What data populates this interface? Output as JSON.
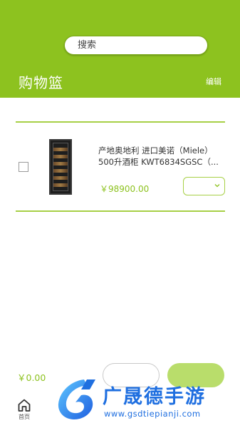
{
  "header": {
    "search_placeholder": "搜索",
    "title": "购物篮",
    "edit_label": "编辑"
  },
  "cart": {
    "items": [
      {
        "checked": false,
        "name_line1": "产地奥地利 进口美诺（Miele）",
        "name_line2": "500升酒柜 KWT6834SGSC（...",
        "price": "￥98900.00",
        "quantity": ""
      }
    ]
  },
  "summary": {
    "total": "￥0.00",
    "secondary_button_label": "",
    "primary_button_label": ""
  },
  "nav": {
    "home_label": "首页"
  },
  "watermark": {
    "brand": "广晟德手游",
    "url": "www.gsdtiepianji.com"
  },
  "colors": {
    "accent": "#8dc21f",
    "accent_light": "#b9dd6b",
    "watermark_blue": "#1f6fe0"
  }
}
